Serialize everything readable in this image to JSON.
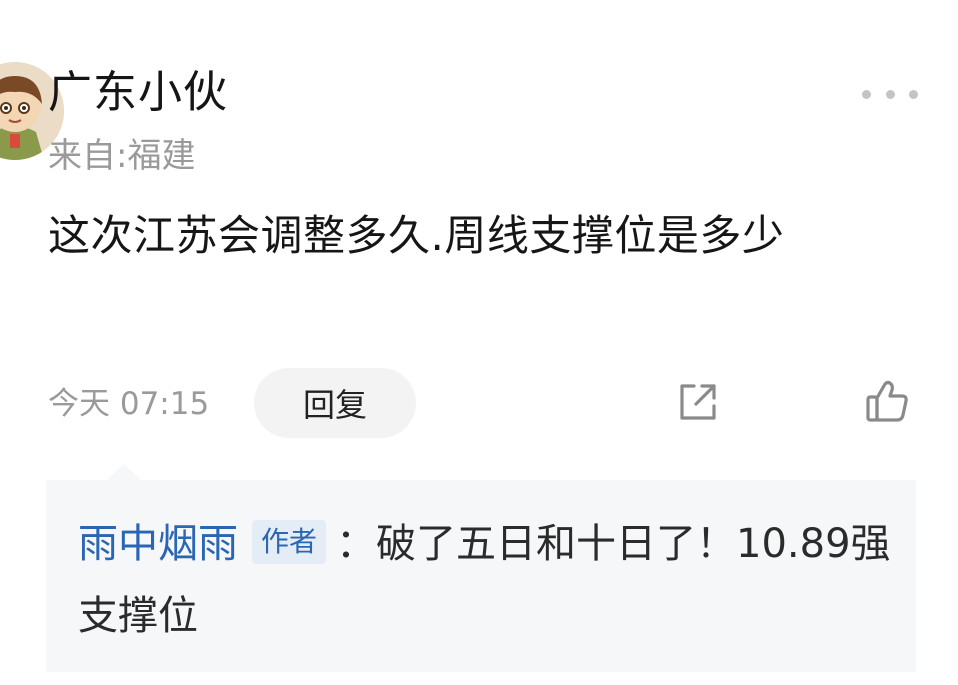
{
  "post": {
    "username": "广东小伙",
    "location": "来自:福建",
    "content": "这次江苏会调整多久.周线支撑位是多少",
    "time": "今天 07:15",
    "reply_label": "回复",
    "icons": {
      "avatar": "cartoon-avatar",
      "more": "more-horizontal-icon",
      "share": "share-external-icon",
      "like": "thumbs-up-icon"
    }
  },
  "reply": {
    "author": "雨中烟雨",
    "author_tag": "作者",
    "text": "：破了五日和十日了！10.89强支撑位"
  },
  "colors": {
    "author_blue": "#2a66b3",
    "reply_bg": "#f6f7f9",
    "muted_text": "#9a9a9a"
  }
}
